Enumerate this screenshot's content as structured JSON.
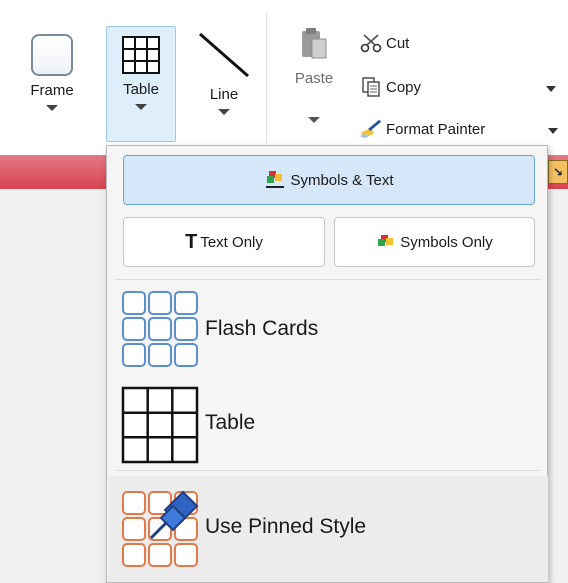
{
  "ribbon": {
    "frame_label": "Frame",
    "table_label": "Table",
    "line_label": "Line",
    "paste_label": "Paste",
    "cut_label": "Cut",
    "copy_label": "Copy",
    "format_painter_label": "Format Painter"
  },
  "dropdown": {
    "symbols_text_label": "Symbols & Text",
    "text_only_label": "Text Only",
    "symbols_only_label": "Symbols Only",
    "flash_cards_label": "Flash Cards",
    "table_label": "Table",
    "pinned_style_label": "Use Pinned Style"
  },
  "colors": {
    "accent_blue": "#4a86c8",
    "selection_bg": "#d5e7f8",
    "pinned_orange": "#e07a4a",
    "flash_blue": "#6aa3d6",
    "strip_red": "#d7424f"
  }
}
